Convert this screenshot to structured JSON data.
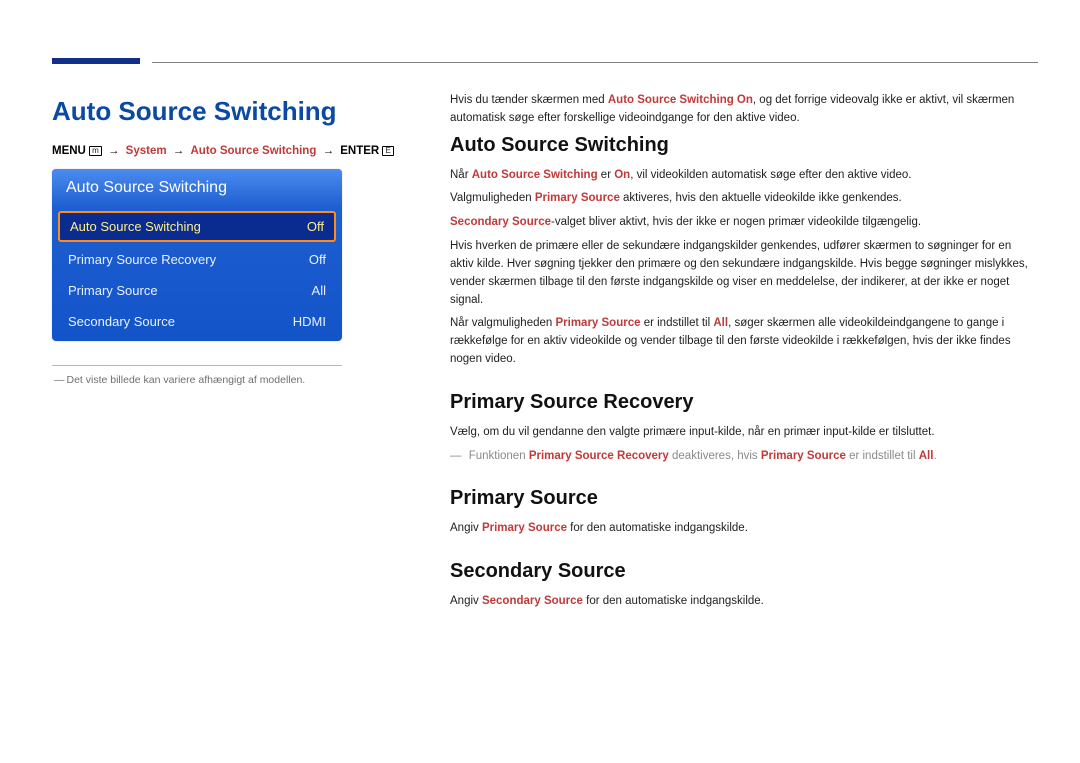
{
  "page_title": "Auto Source Switching",
  "nav": {
    "menu": "MENU",
    "system": "System",
    "item": "Auto Source Switching",
    "enter": "ENTER"
  },
  "osd": {
    "header": "Auto Source Switching",
    "rows": [
      {
        "label": "Auto Source Switching",
        "value": "Off"
      },
      {
        "label": "Primary Source Recovery",
        "value": "Off"
      },
      {
        "label": "Primary Source",
        "value": "All"
      },
      {
        "label": "Secondary Source",
        "value": "HDMI"
      }
    ]
  },
  "footnote": "Det viste billede kan variere afhængigt af modellen.",
  "intro": {
    "pre": "Hvis du tænder skærmen med ",
    "bold": "Auto Source Switching On",
    "post": ", og det forrige videovalg ikke er aktivt, vil skærmen automatisk søge efter forskellige videoindgange for den aktive video."
  },
  "sections": {
    "ass": {
      "heading": "Auto Source Switching",
      "p1_pre": "Når ",
      "p1_b": "Auto Source Switching",
      "p1_mid": " er ",
      "p1_b2": "On",
      "p1_post": ", vil videokilden automatisk søge efter den aktive video.",
      "p2_pre": "Valgmuligheden ",
      "p2_b": "Primary Source",
      "p2_post": " aktiveres, hvis den aktuelle videokilde ikke genkendes.",
      "p3_b": "Secondary Source",
      "p3_post": "-valget bliver aktivt, hvis der ikke er nogen primær videokilde tilgængelig.",
      "p4": "Hvis hverken de primære eller de sekundære indgangskilder genkendes, udfører skærmen to søgninger for en aktiv kilde. Hver søgning tjekker den primære og den sekundære indgangskilde. Hvis begge søgninger mislykkes, vender skærmen tilbage til den første indgangskilde og viser en meddelelse, der indikerer, at der ikke er noget signal.",
      "p5_pre": "Når valgmuligheden ",
      "p5_b": "Primary Source",
      "p5_mid": " er indstillet til ",
      "p5_b2": "All",
      "p5_post": ", søger skærmen alle videokildeindgangene to gange i rækkefølge for en aktiv videokilde og vender tilbage til den første videokilde i rækkefølgen, hvis der ikke findes nogen video."
    },
    "psr": {
      "heading": "Primary Source Recovery",
      "p1": "Vælg, om du vil gendanne den valgte primære input-kilde, når en primær input-kilde er tilsluttet.",
      "note_pre": "Funktionen ",
      "note_b1": "Primary Source Recovery",
      "note_mid": " deaktiveres, hvis ",
      "note_b2": "Primary Source",
      "note_mid2": " er indstillet til ",
      "note_b3": "All",
      "note_post": "."
    },
    "ps": {
      "heading": "Primary Source",
      "p_pre": "Angiv ",
      "p_b": "Primary Source",
      "p_post": " for den automatiske indgangskilde."
    },
    "ss": {
      "heading": "Secondary Source",
      "p_pre": "Angiv ",
      "p_b": "Secondary Source",
      "p_post": " for den automatiske indgangskilde."
    }
  }
}
